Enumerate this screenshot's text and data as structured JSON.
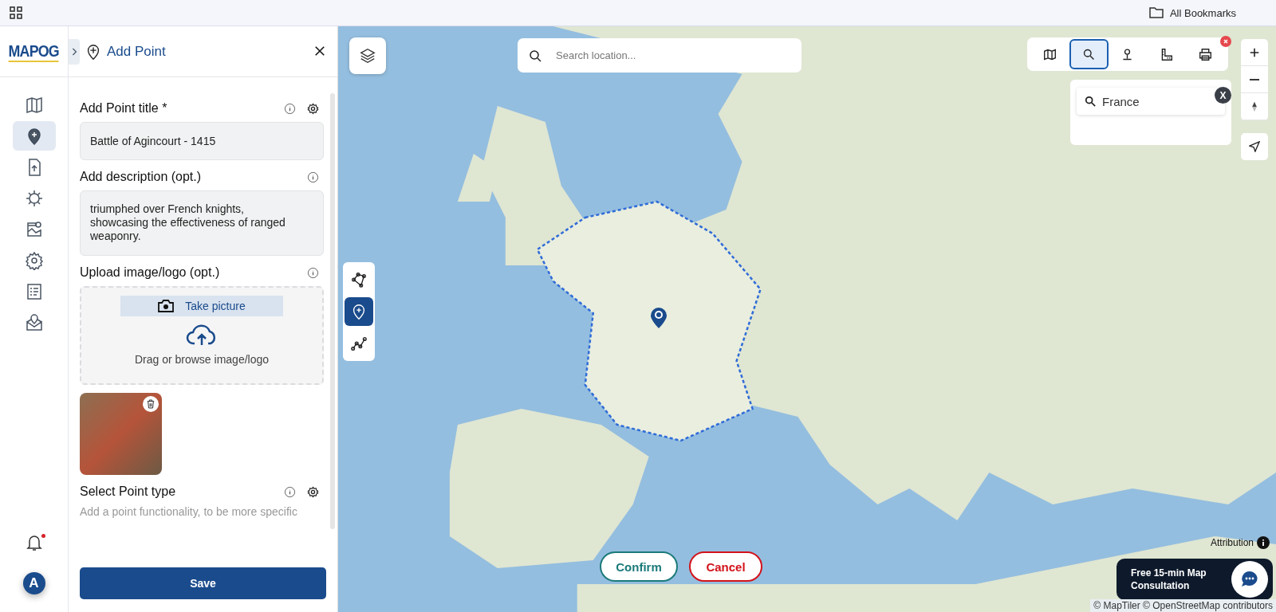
{
  "browser_bar": {
    "bookmarks": "All Bookmarks"
  },
  "logo": {
    "text": "MAPOG"
  },
  "nav": [
    {
      "kind": "map",
      "selected": false
    },
    {
      "kind": "point",
      "selected": true
    },
    {
      "kind": "upload",
      "selected": false
    },
    {
      "kind": "gear",
      "selected": false
    },
    {
      "kind": "map-photo",
      "selected": false
    },
    {
      "kind": "settings",
      "selected": false
    },
    {
      "kind": "list",
      "selected": false
    },
    {
      "kind": "mail-pin",
      "selected": false
    }
  ],
  "notifications": {
    "unread": true
  },
  "avatar": {
    "initial": "A"
  },
  "panel": {
    "title": "Add Point",
    "title_field": {
      "label": "Add Point title *",
      "value": "Battle of Agincourt - 1415"
    },
    "description_field": {
      "label": "Add description (opt.)",
      "value": "triumphed over French knights, showcasing the effectiveness of ranged weaponry."
    },
    "upload": {
      "label": "Upload image/logo (opt.)",
      "take_picture": "Take picture",
      "hint": "Drag or browse image/logo"
    },
    "point_type": {
      "label": "Select Point type",
      "hint": "Add a point functionality, to be more specific"
    },
    "save": "Save"
  },
  "map": {
    "search": {
      "placeholder": "Search location..."
    },
    "draw_tools": [
      {
        "kind": "polygon",
        "selected": false
      },
      {
        "kind": "point",
        "selected": true
      },
      {
        "kind": "line",
        "selected": false
      }
    ],
    "toolbar": [
      {
        "kind": "map",
        "selected": false
      },
      {
        "kind": "search",
        "selected": true
      },
      {
        "kind": "pin",
        "selected": false
      },
      {
        "kind": "ruler",
        "selected": false
      },
      {
        "kind": "print",
        "selected": false
      }
    ],
    "place_search": {
      "value": "France",
      "close": "X"
    },
    "confirm": "Confirm",
    "cancel": "Cancel",
    "consultation": "Free 15-min Map Consultation",
    "attribution": "Attribution",
    "copyright": "© MapTiler © OpenStreetMap contributors"
  }
}
